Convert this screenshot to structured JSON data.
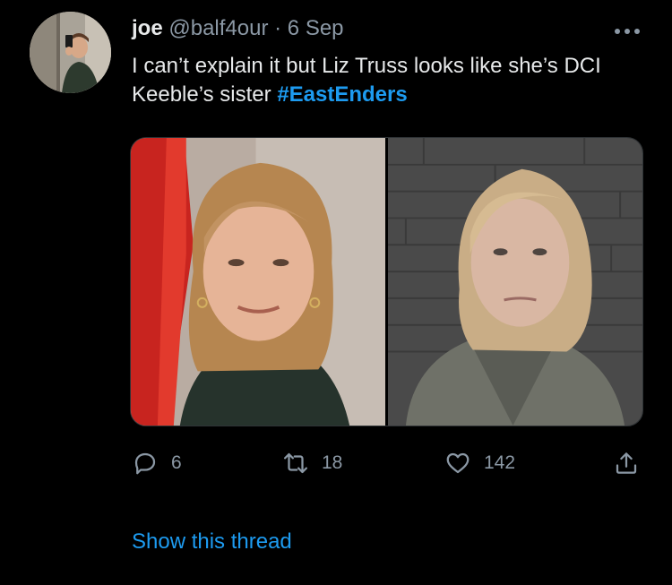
{
  "tweet": {
    "author_name": "joe",
    "author_handle": "@balf4our",
    "separator": "·",
    "date": "6 Sep",
    "text_before": "I can’t explain it but Liz Truss looks like she’s DCI Keeble’s sister ",
    "hashtag": "#EastEnders"
  },
  "actions": {
    "replies": "6",
    "retweets": "18",
    "likes": "142",
    "reply_icon": "reply-icon",
    "retweet_icon": "retweet-icon",
    "like_icon": "heart-icon",
    "share_icon": "share-icon"
  },
  "thread": {
    "show_label": "Show this thread"
  },
  "colors": {
    "background": "#000000",
    "text": "#e7e9ea",
    "secondary": "#8b98a5",
    "accent": "#1d9bf0"
  }
}
